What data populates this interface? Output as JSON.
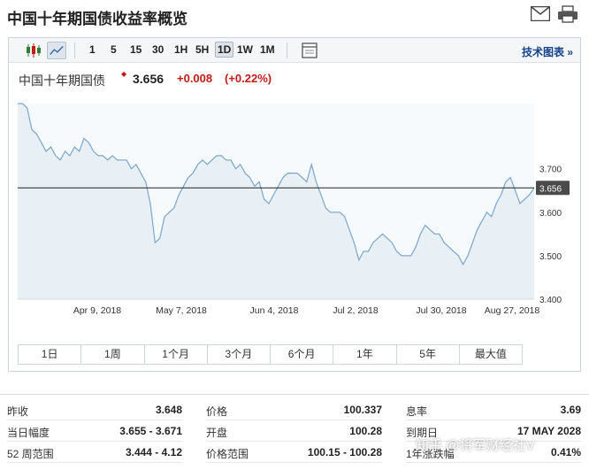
{
  "header": {
    "title": "中国十年期国债收益率概览"
  },
  "toolbar": {
    "periods": [
      "1",
      "5",
      "15",
      "30",
      "1H",
      "5H",
      "1D",
      "1W",
      "1M"
    ],
    "active_period": "1D",
    "tech_chart": "技术图表 »"
  },
  "quote": {
    "name": "中国十年期国债",
    "price": "3.656",
    "change": "+0.008",
    "change_pct": "(+0.22%)"
  },
  "chart_data": {
    "type": "area",
    "x_ticks": [
      "Apr 9, 2018",
      "May 7, 2018",
      "Jun 4, 2018",
      "Jul 2, 2018",
      "Jul 30, 2018",
      "Aug 27, 2018"
    ],
    "y_ticks": [
      "3.700",
      "3.600",
      "3.500",
      "3.400"
    ],
    "ylim": [
      3.4,
      3.85
    ],
    "current_value_label": "3.656",
    "current_value": 3.656,
    "grid": false,
    "values": [
      3.85,
      3.85,
      3.84,
      3.79,
      3.78,
      3.76,
      3.74,
      3.75,
      3.73,
      3.72,
      3.74,
      3.73,
      3.75,
      3.74,
      3.77,
      3.76,
      3.74,
      3.73,
      3.73,
      3.72,
      3.73,
      3.72,
      3.72,
      3.72,
      3.7,
      3.71,
      3.69,
      3.67,
      3.62,
      3.53,
      3.54,
      3.59,
      3.6,
      3.61,
      3.64,
      3.66,
      3.68,
      3.69,
      3.71,
      3.72,
      3.71,
      3.72,
      3.73,
      3.73,
      3.72,
      3.72,
      3.7,
      3.71,
      3.69,
      3.68,
      3.66,
      3.67,
      3.63,
      3.62,
      3.64,
      3.66,
      3.68,
      3.69,
      3.69,
      3.69,
      3.68,
      3.67,
      3.71,
      3.67,
      3.64,
      3.61,
      3.6,
      3.6,
      3.6,
      3.59,
      3.56,
      3.53,
      3.49,
      3.51,
      3.51,
      3.53,
      3.54,
      3.55,
      3.54,
      3.53,
      3.51,
      3.5,
      3.5,
      3.5,
      3.52,
      3.55,
      3.57,
      3.56,
      3.55,
      3.55,
      3.53,
      3.52,
      3.51,
      3.5,
      3.48,
      3.5,
      3.53,
      3.56,
      3.58,
      3.6,
      3.59,
      3.62,
      3.64,
      3.67,
      3.68,
      3.65,
      3.62,
      3.63,
      3.64,
      3.656
    ]
  },
  "range_tabs": [
    "1日",
    "1周",
    "1个月",
    "3个月",
    "6个月",
    "1年",
    "5年",
    "最大值"
  ],
  "stats": {
    "col1": [
      {
        "label": "昨收",
        "value": "3.648"
      },
      {
        "label": "当日幅度",
        "value": "3.655 - 3.671"
      },
      {
        "label": "52 周范围",
        "value": "3.444 - 4.12"
      }
    ],
    "col2": [
      {
        "label": "价格",
        "value": "100.337"
      },
      {
        "label": "开盘",
        "value": "100.28"
      },
      {
        "label": "价格范围",
        "value": "100.15 - 100.28"
      }
    ],
    "col3": [
      {
        "label": "息率",
        "value": "3.69"
      },
      {
        "label": "到期日",
        "value": "17 MAY 2028"
      },
      {
        "label": "1年涨跌幅",
        "value": "0.41%"
      }
    ]
  },
  "watermark": "知乎 @将军财经社V",
  "colors": {
    "accent": "#14428a",
    "up": "#c41a1a",
    "line": "#7aa6cc",
    "area": "#e8eff5"
  }
}
